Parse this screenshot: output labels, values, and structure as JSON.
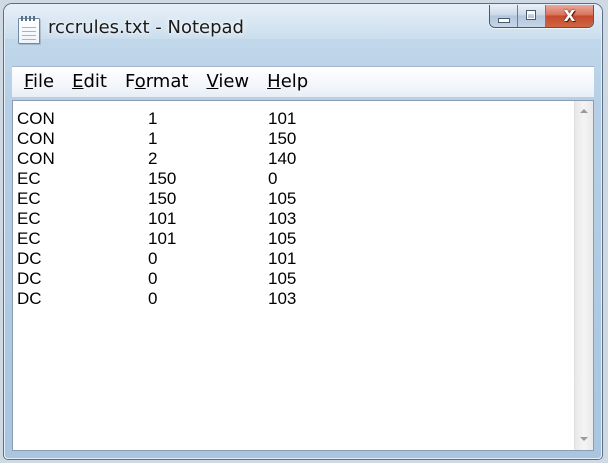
{
  "window": {
    "title": "rccrules.txt - Notepad",
    "app_icon": "notepad-icon",
    "caption_buttons": {
      "minimize_icon": "minimize-icon",
      "maximize_icon": "maximize-icon",
      "close_icon": "close-icon",
      "close_glyph": "X",
      "close_color": "#c7503a"
    }
  },
  "menu": {
    "items": [
      {
        "label": "File",
        "accel": "F"
      },
      {
        "label": "Edit",
        "accel": "E"
      },
      {
        "label": "Format",
        "accel": "o"
      },
      {
        "label": "View",
        "accel": "V"
      },
      {
        "label": "Help",
        "accel": "H"
      }
    ]
  },
  "document": {
    "rows": [
      [
        "CON",
        "1",
        "101"
      ],
      [
        "CON",
        "1",
        "150"
      ],
      [
        "CON",
        "2",
        "140"
      ],
      [
        "EC",
        "150",
        "0"
      ],
      [
        "EC",
        "150",
        "105"
      ],
      [
        "EC",
        "101",
        "103"
      ],
      [
        "EC",
        "101",
        "105"
      ],
      [
        "DC",
        "0",
        "101"
      ],
      [
        "DC",
        "0",
        "105"
      ],
      [
        "DC",
        "0",
        "103"
      ]
    ]
  },
  "scrollbar": {
    "up_icon": "scroll-up-arrow-icon",
    "down_icon": "scroll-down-arrow-icon"
  }
}
